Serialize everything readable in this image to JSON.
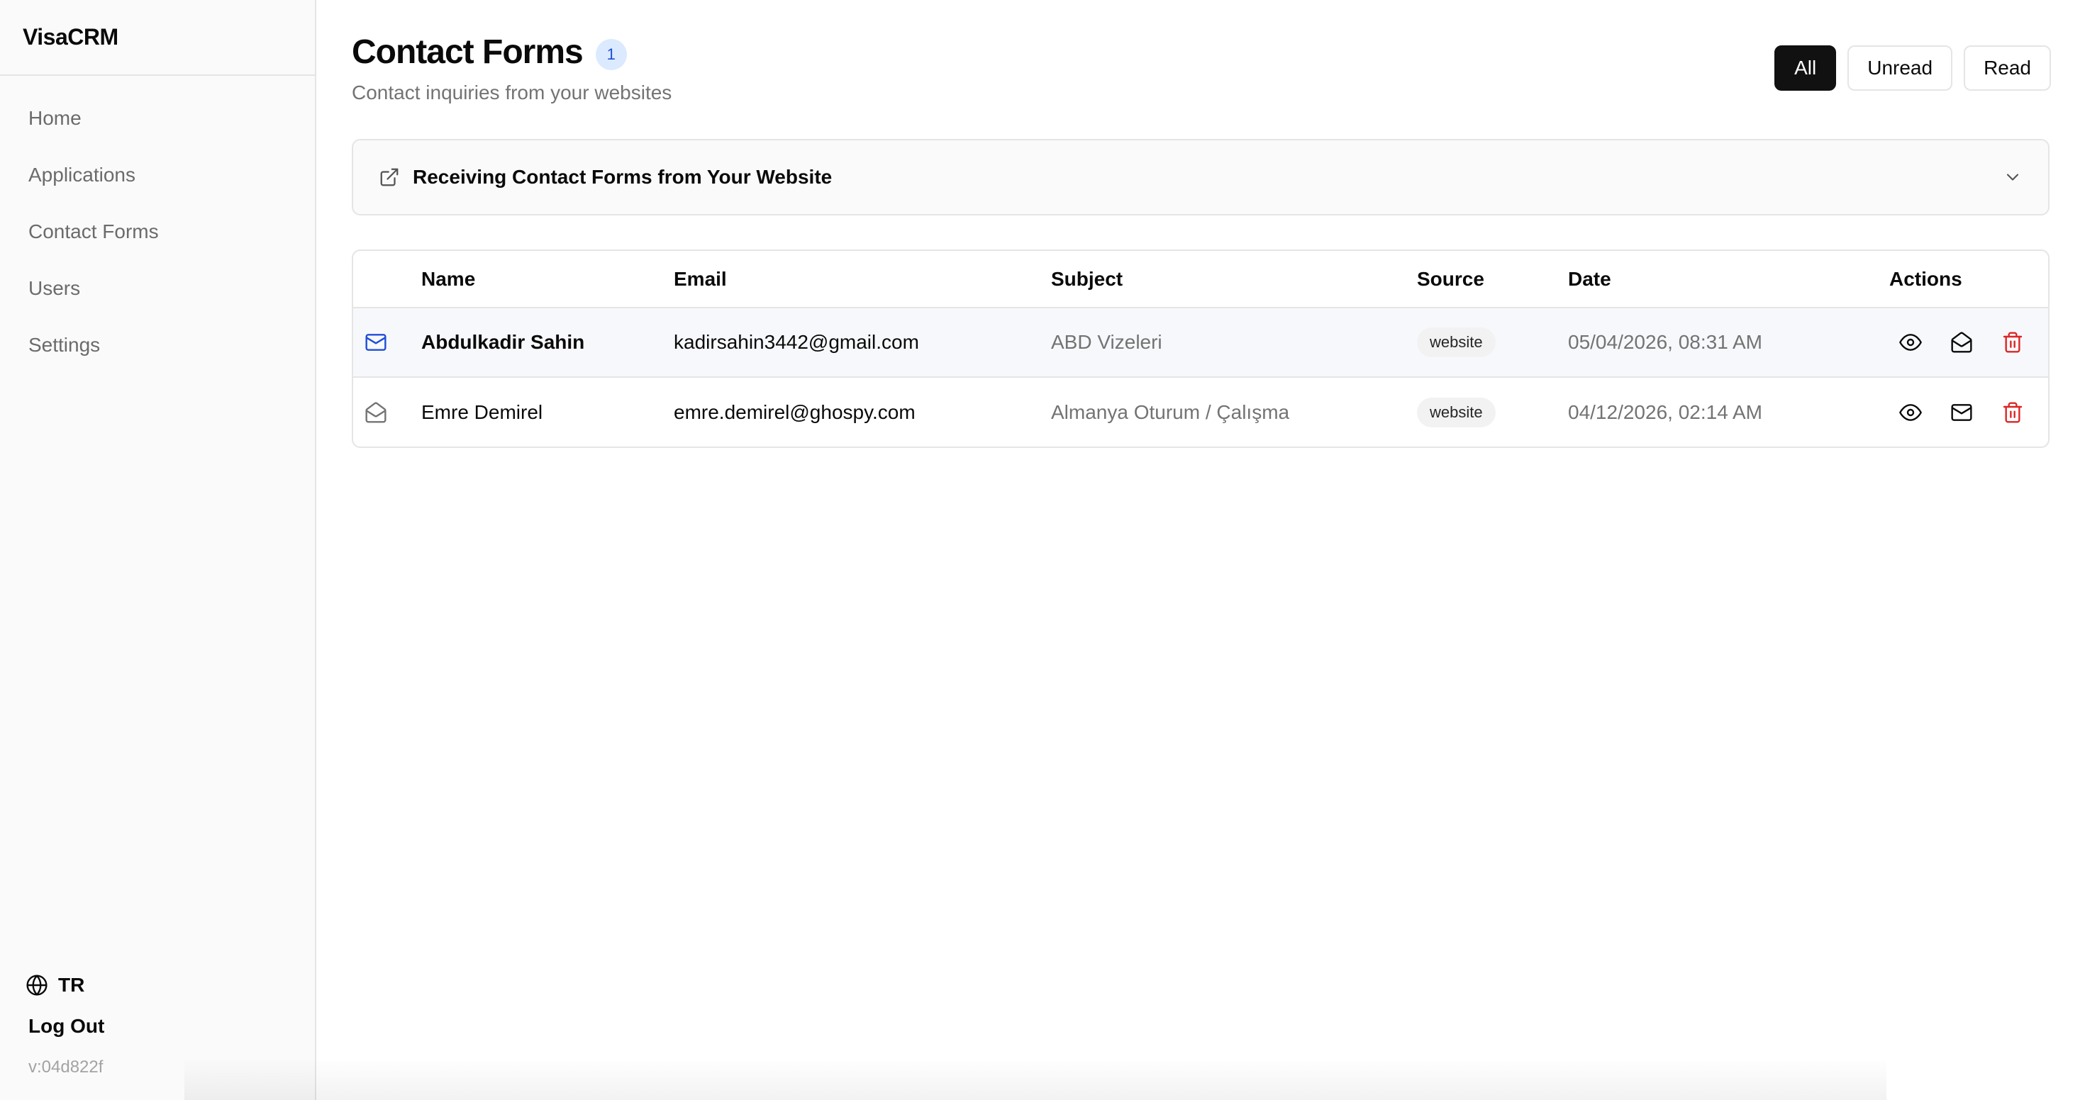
{
  "app": {
    "brand": "VisaCRM"
  },
  "sidebar": {
    "items": [
      {
        "label": "Home"
      },
      {
        "label": "Applications"
      },
      {
        "label": "Contact Forms"
      },
      {
        "label": "Users"
      },
      {
        "label": "Settings"
      }
    ],
    "language": "TR",
    "logout_label": "Log Out",
    "version": "v:04d822f"
  },
  "header": {
    "title": "Contact Forms",
    "count": "1",
    "subtitle": "Contact inquiries from your websites"
  },
  "filters": {
    "all": "All",
    "unread": "Unread",
    "read": "Read",
    "selected": "All"
  },
  "info_panel": {
    "label": "Receiving Contact Forms from Your Website"
  },
  "table": {
    "columns": {
      "name": "Name",
      "email": "Email",
      "subject": "Subject",
      "source": "Source",
      "date": "Date",
      "actions": "Actions"
    },
    "rows": [
      {
        "name": "Abdulkadir Sahin",
        "email": "kadirsahin3442@gmail.com",
        "subject": "ABD Vizeleri",
        "source": "website",
        "date": "05/04/2026, 08:31 AM",
        "status": "unread",
        "status_icon": "mail-icon",
        "toggle_icon": "mail-open-icon"
      },
      {
        "name": "Emre Demirel",
        "email": "emre.demirel@ghospy.com",
        "subject": "Almanya Oturum / Çalışma",
        "source": "website",
        "date": "04/12/2026, 02:14 AM",
        "status": "read",
        "status_icon": "mail-open-icon",
        "toggle_icon": "mail-icon"
      }
    ]
  },
  "colors": {
    "accent": "#111111",
    "unread_icon": "#1d4ed8",
    "delete": "#dc2626",
    "badge_bg": "#dbeafe"
  }
}
